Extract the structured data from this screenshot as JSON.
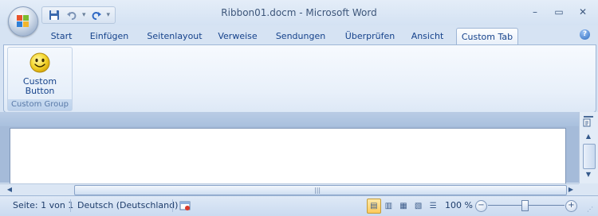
{
  "window": {
    "title": "Ribbon01.docm - Microsoft Word",
    "minimize_label": "–",
    "maximize_label": "▭",
    "close_label": "✕"
  },
  "quick_access": {
    "save_icon": "save-icon",
    "undo_icon": "undo-icon",
    "redo_icon": "redo-icon",
    "customize_glyph": "▾"
  },
  "tabs": [
    {
      "label": "Start",
      "active": false
    },
    {
      "label": "Einfügen",
      "active": false
    },
    {
      "label": "Seitenlayout",
      "active": false
    },
    {
      "label": "Verweise",
      "active": false
    },
    {
      "label": "Sendungen",
      "active": false
    },
    {
      "label": "Überprüfen",
      "active": false
    },
    {
      "label": "Ansicht",
      "active": false
    },
    {
      "label": "Custom Tab",
      "active": true
    }
  ],
  "help_label": "?",
  "ribbon": {
    "group_label": "Custom Group",
    "button_line1": "Custom",
    "button_line2": "Button",
    "button_icon": "smiley-icon"
  },
  "statusbar": {
    "page_info": "Seite: 1 von 1",
    "language": "Deutsch (Deutschland)",
    "zoom_text": "100 %",
    "zoom_percent": 100,
    "zoom_minus": "−",
    "zoom_plus": "+"
  },
  "colors": {
    "accent": "#15428b",
    "frame": "#d6e3f3"
  }
}
